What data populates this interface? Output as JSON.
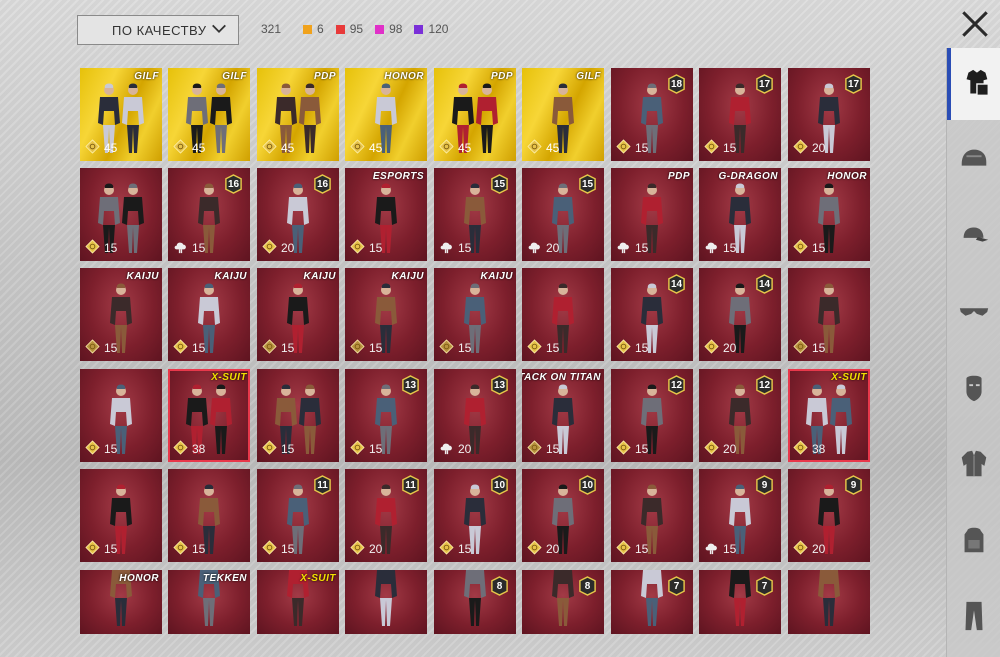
{
  "toolbar": {
    "sort_label": "ПО КАЧЕСТВУ",
    "total_count": "321",
    "legend": [
      {
        "color": "#f0a21c",
        "count": "6",
        "name": "gold"
      },
      {
        "color": "#e83a3a",
        "count": "95",
        "name": "red"
      },
      {
        "color": "#e030c8",
        "count": "98",
        "name": "pink"
      },
      {
        "color": "#7a2fd8",
        "count": "120",
        "name": "purple"
      }
    ]
  },
  "side_tabs": [
    "outfit-icon",
    "helmet-icon",
    "cap-icon",
    "glasses-icon",
    "mask-icon",
    "jacket-icon",
    "backpack-icon",
    "pants-icon"
  ],
  "grid": {
    "rows": [
      [
        {
          "bg": "gold",
          "brand": "GILF",
          "badge": "",
          "price": "45",
          "coin": "gold",
          "figs": 2
        },
        {
          "bg": "gold",
          "brand": "GILF",
          "badge": "",
          "price": "45",
          "coin": "gold",
          "figs": 2
        },
        {
          "bg": "gold",
          "brand": "PDP",
          "badge": "",
          "price": "45",
          "coin": "gold",
          "figs": 2
        },
        {
          "bg": "gold",
          "brand": "HONOR",
          "badge": "",
          "price": "45",
          "coin": "gold",
          "figs": 1
        },
        {
          "bg": "gold",
          "brand": "PDP",
          "badge": "",
          "price": "45",
          "coin": "gold",
          "figs": 2
        },
        {
          "bg": "gold",
          "brand": "GILF",
          "badge": "",
          "price": "45",
          "coin": "gold",
          "figs": 1
        },
        {
          "bg": "red",
          "brand": "",
          "badge": "18",
          "price": "15",
          "coin": "gold",
          "figs": 1
        },
        {
          "bg": "red",
          "brand": "",
          "badge": "17",
          "price": "15",
          "coin": "gold",
          "figs": 1
        },
        {
          "bg": "red",
          "brand": "",
          "badge": "17",
          "price": "20",
          "coin": "gold",
          "figs": 1
        }
      ],
      [
        {
          "bg": "red",
          "brand": "",
          "badge": "",
          "price": "15",
          "coin": "gold",
          "figs": 2
        },
        {
          "bg": "red",
          "brand": "",
          "badge": "16",
          "price": "15",
          "coin": "cloud",
          "figs": 1
        },
        {
          "bg": "red",
          "brand": "",
          "badge": "16",
          "price": "20",
          "coin": "gold",
          "figs": 1
        },
        {
          "bg": "red",
          "brand": "ESPORTS",
          "badge": "",
          "price": "15",
          "coin": "gold",
          "figs": 1
        },
        {
          "bg": "red",
          "brand": "",
          "badge": "15",
          "price": "15",
          "coin": "cloud",
          "figs": 1
        },
        {
          "bg": "red",
          "brand": "",
          "badge": "15",
          "price": "20",
          "coin": "cloud",
          "figs": 1
        },
        {
          "bg": "red",
          "brand": "PDP",
          "badge": "",
          "price": "15",
          "coin": "cloud",
          "figs": 1
        },
        {
          "bg": "red",
          "brand": "G-DRAGON",
          "badge": "",
          "price": "15",
          "coin": "cloud",
          "figs": 1
        },
        {
          "bg": "red",
          "brand": "HONOR",
          "badge": "",
          "price": "15",
          "coin": "gold",
          "figs": 1
        }
      ],
      [
        {
          "bg": "red",
          "brand": "KAIJU",
          "badge": "",
          "price": "15",
          "coin": "bronze",
          "figs": 1
        },
        {
          "bg": "red",
          "brand": "KAIJU",
          "badge": "",
          "price": "15",
          "coin": "gold",
          "figs": 1
        },
        {
          "bg": "red",
          "brand": "KAIJU",
          "badge": "",
          "price": "15",
          "coin": "bronze",
          "figs": 1
        },
        {
          "bg": "red",
          "brand": "KAIJU",
          "badge": "",
          "price": "15",
          "coin": "bronze",
          "figs": 1
        },
        {
          "bg": "red",
          "brand": "KAIJU",
          "badge": "",
          "price": "15",
          "coin": "bronze",
          "figs": 1
        },
        {
          "bg": "red",
          "brand": "",
          "badge": "",
          "price": "15",
          "coin": "gold",
          "figs": 1
        },
        {
          "bg": "red",
          "brand": "",
          "badge": "14",
          "price": "15",
          "coin": "gold",
          "figs": 1
        },
        {
          "bg": "red",
          "brand": "",
          "badge": "14",
          "price": "20",
          "coin": "gold",
          "figs": 1
        },
        {
          "bg": "red",
          "brand": "",
          "badge": "",
          "price": "15",
          "coin": "bronze",
          "figs": 1
        }
      ],
      [
        {
          "bg": "red",
          "brand": "",
          "badge": "",
          "price": "15",
          "coin": "gold",
          "figs": 1
        },
        {
          "bg": "red",
          "brand": "X-SUIT",
          "badge": "",
          "price": "38",
          "coin": "gold",
          "figs": 2
        },
        {
          "bg": "red",
          "brand": "",
          "badge": "",
          "price": "15",
          "coin": "gold",
          "figs": 2
        },
        {
          "bg": "red",
          "brand": "",
          "badge": "13",
          "price": "15",
          "coin": "gold",
          "figs": 1
        },
        {
          "bg": "red",
          "brand": "",
          "badge": "13",
          "price": "20",
          "coin": "cloud",
          "figs": 1
        },
        {
          "bg": "red",
          "brand": "ATTACK ON TITAN",
          "badge": "",
          "price": "15",
          "coin": "bronze",
          "figs": 1
        },
        {
          "bg": "red",
          "brand": "",
          "badge": "12",
          "price": "15",
          "coin": "gold",
          "figs": 1
        },
        {
          "bg": "red",
          "brand": "",
          "badge": "12",
          "price": "20",
          "coin": "gold",
          "figs": 1
        },
        {
          "bg": "red",
          "brand": "X-SUIT",
          "badge": "",
          "price": "38",
          "coin": "gold",
          "figs": 2
        }
      ],
      [
        {
          "bg": "red",
          "brand": "",
          "badge": "",
          "price": "15",
          "coin": "gold",
          "figs": 1
        },
        {
          "bg": "red",
          "brand": "",
          "badge": "",
          "price": "15",
          "coin": "gold",
          "figs": 1
        },
        {
          "bg": "red",
          "brand": "",
          "badge": "11",
          "price": "15",
          "coin": "gold",
          "figs": 1
        },
        {
          "bg": "red",
          "brand": "",
          "badge": "11",
          "price": "20",
          "coin": "gold",
          "figs": 1
        },
        {
          "bg": "red",
          "brand": "",
          "badge": "10",
          "price": "15",
          "coin": "gold",
          "figs": 1
        },
        {
          "bg": "red",
          "brand": "",
          "badge": "10",
          "price": "20",
          "coin": "gold",
          "figs": 1
        },
        {
          "bg": "red",
          "brand": "",
          "badge": "",
          "price": "15",
          "coin": "gold",
          "figs": 1
        },
        {
          "bg": "red",
          "brand": "",
          "badge": "9",
          "price": "15",
          "coin": "cloud",
          "figs": 1
        },
        {
          "bg": "red",
          "brand": "",
          "badge": "9",
          "price": "20",
          "coin": "gold",
          "figs": 1
        }
      ],
      [
        {
          "bg": "red",
          "brand": "HONOR",
          "badge": "",
          "price": "",
          "coin": "",
          "figs": 1
        },
        {
          "bg": "red",
          "brand": "TEKKEN",
          "badge": "",
          "price": "",
          "coin": "",
          "figs": 1
        },
        {
          "bg": "red",
          "brand": "X-SUIT",
          "badge": "",
          "price": "",
          "coin": "",
          "figs": 1
        },
        {
          "bg": "red",
          "brand": "",
          "badge": "",
          "price": "",
          "coin": "",
          "figs": 1
        },
        {
          "bg": "red",
          "brand": "",
          "badge": "8",
          "price": "",
          "coin": "",
          "figs": 1
        },
        {
          "bg": "red",
          "brand": "",
          "badge": "8",
          "price": "",
          "coin": "",
          "figs": 1
        },
        {
          "bg": "red",
          "brand": "",
          "badge": "7",
          "price": "",
          "coin": "",
          "figs": 1
        },
        {
          "bg": "red",
          "brand": "",
          "badge": "7",
          "price": "",
          "coin": "",
          "figs": 1
        },
        {
          "bg": "red",
          "brand": "",
          "badge": "",
          "price": "",
          "coin": "",
          "figs": 1
        }
      ]
    ]
  }
}
